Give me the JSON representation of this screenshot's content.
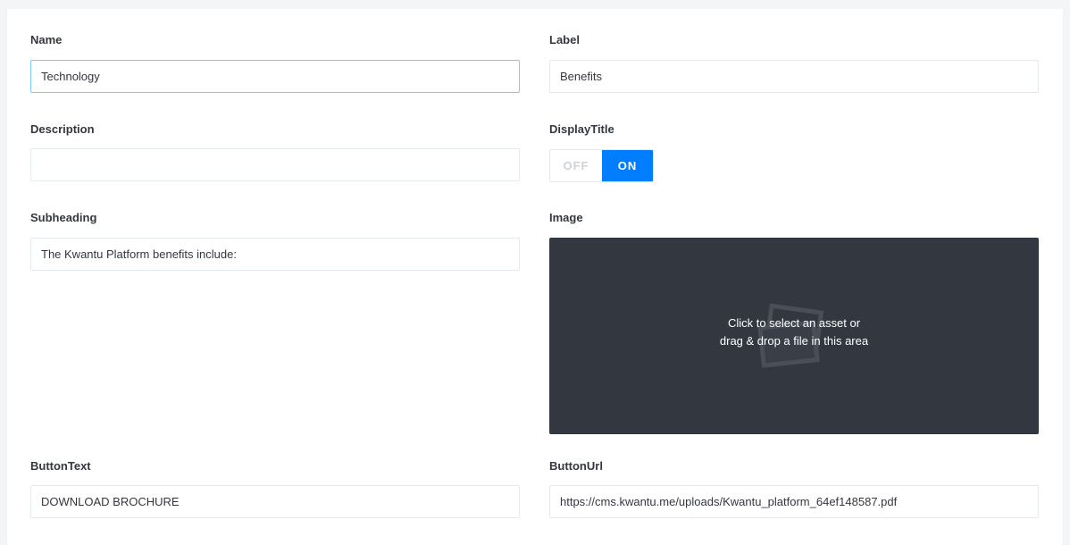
{
  "fields": {
    "name": {
      "label": "Name",
      "value": "Technology"
    },
    "label": {
      "label": "Label",
      "value": "Benefits"
    },
    "description": {
      "label": "Description",
      "value": ""
    },
    "display_title": {
      "label": "DisplayTitle",
      "off_label": "OFF",
      "on_label": "ON",
      "value": "ON"
    },
    "subheading": {
      "label": "Subheading",
      "value": "The Kwantu Platform benefits include:"
    },
    "image": {
      "label": "Image",
      "prompt_line1": "Click to select an asset or",
      "prompt_line2": "drag & drop a file in this area"
    },
    "button_text": {
      "label": "ButtonText",
      "value": "DOWNLOAD BROCHURE"
    },
    "button_url": {
      "label": "ButtonUrl",
      "value": "https://cms.kwantu.me/uploads/Kwantu_platform_64ef148587.pdf"
    }
  },
  "colors": {
    "accent": "#007eff",
    "focus_border": "#78caff",
    "dropzone_bg": "#333740",
    "input_border": "#e3e9f3"
  },
  "icons": {
    "dropzone": "image-placeholder-icon"
  }
}
